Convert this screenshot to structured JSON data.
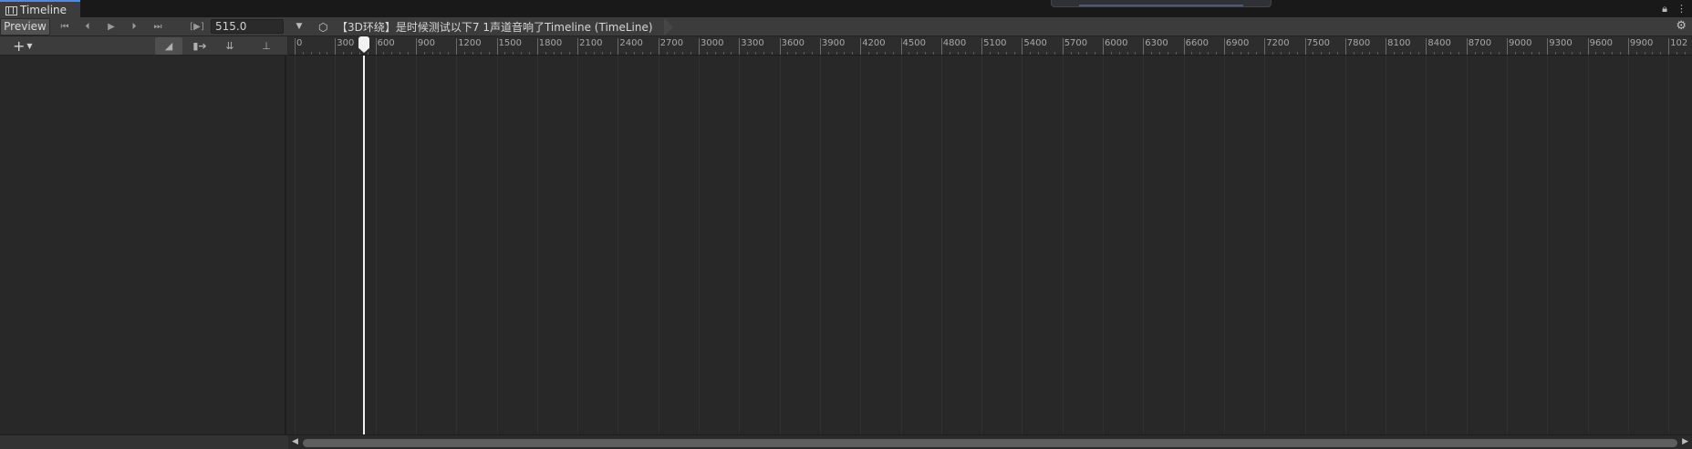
{
  "window": {
    "tab_title": "Timeline",
    "icons": {
      "tab": "film-icon",
      "lock": "lock-icon",
      "menu": "kebab-menu-icon"
    }
  },
  "toolbar": {
    "preview_label": "Preview",
    "controls": [
      {
        "name": "goto-start-button",
        "glyph": "⏮"
      },
      {
        "name": "prev-frame-button",
        "glyph": "⏴"
      },
      {
        "name": "play-button",
        "glyph": "▶"
      },
      {
        "name": "next-frame-button",
        "glyph": "⏵"
      },
      {
        "name": "goto-end-button",
        "glyph": "⏭"
      }
    ],
    "frame_icon": "[▶]",
    "current_frame": "515.0",
    "breadcrumb": "【3D环绕】是时候测试以下7 1声道音响了Timeline (TimeLine)",
    "settings_icon": "gear-icon"
  },
  "track_toolbar": {
    "add_label": "+",
    "buttons": [
      {
        "name": "snap-button",
        "glyph": "◢",
        "active": true
      },
      {
        "name": "ripple-button",
        "glyph": "▮➔",
        "active": false
      },
      {
        "name": "edit-mode-button",
        "glyph": "⇊",
        "active": false
      },
      {
        "name": "pin-button",
        "glyph": "⊥",
        "active": false
      }
    ]
  },
  "ruler": {
    "labels": [
      "0",
      "300",
      "600",
      "900",
      "1200",
      "1500",
      "1800",
      "2100",
      "2400",
      "2700",
      "3000",
      "3300",
      "3600",
      "3900",
      "4200",
      "4500",
      "4800",
      "5100",
      "5400",
      "5700",
      "6000",
      "6300",
      "6600",
      "6900",
      "7200",
      "7500",
      "7800",
      "8100",
      "8400",
      "8700",
      "9000",
      "9300",
      "9600",
      "9900",
      "102"
    ],
    "playhead_frame": 515
  },
  "colors": {
    "accent": "#4a8ae8",
    "playhead": "#f2f2f2"
  }
}
